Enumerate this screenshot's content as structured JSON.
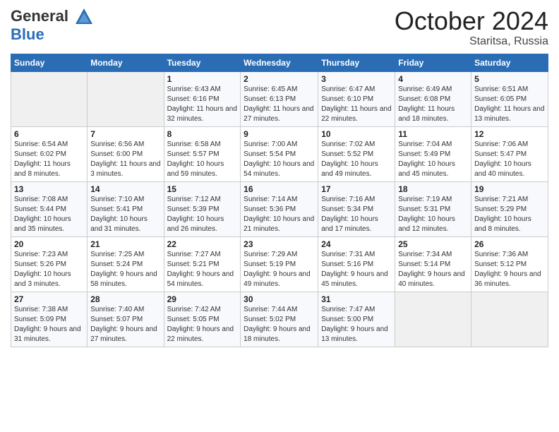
{
  "header": {
    "logo_line1": "General",
    "logo_line2": "Blue",
    "month": "October 2024",
    "location": "Staritsa, Russia"
  },
  "days_of_week": [
    "Sunday",
    "Monday",
    "Tuesday",
    "Wednesday",
    "Thursday",
    "Friday",
    "Saturday"
  ],
  "weeks": [
    [
      {
        "day": "",
        "sunrise": "",
        "sunset": "",
        "daylight": ""
      },
      {
        "day": "",
        "sunrise": "",
        "sunset": "",
        "daylight": ""
      },
      {
        "day": "1",
        "sunrise": "Sunrise: 6:43 AM",
        "sunset": "Sunset: 6:16 PM",
        "daylight": "Daylight: 11 hours and 32 minutes."
      },
      {
        "day": "2",
        "sunrise": "Sunrise: 6:45 AM",
        "sunset": "Sunset: 6:13 PM",
        "daylight": "Daylight: 11 hours and 27 minutes."
      },
      {
        "day": "3",
        "sunrise": "Sunrise: 6:47 AM",
        "sunset": "Sunset: 6:10 PM",
        "daylight": "Daylight: 11 hours and 22 minutes."
      },
      {
        "day": "4",
        "sunrise": "Sunrise: 6:49 AM",
        "sunset": "Sunset: 6:08 PM",
        "daylight": "Daylight: 11 hours and 18 minutes."
      },
      {
        "day": "5",
        "sunrise": "Sunrise: 6:51 AM",
        "sunset": "Sunset: 6:05 PM",
        "daylight": "Daylight: 11 hours and 13 minutes."
      }
    ],
    [
      {
        "day": "6",
        "sunrise": "Sunrise: 6:54 AM",
        "sunset": "Sunset: 6:02 PM",
        "daylight": "Daylight: 11 hours and 8 minutes."
      },
      {
        "day": "7",
        "sunrise": "Sunrise: 6:56 AM",
        "sunset": "Sunset: 6:00 PM",
        "daylight": "Daylight: 11 hours and 3 minutes."
      },
      {
        "day": "8",
        "sunrise": "Sunrise: 6:58 AM",
        "sunset": "Sunset: 5:57 PM",
        "daylight": "Daylight: 10 hours and 59 minutes."
      },
      {
        "day": "9",
        "sunrise": "Sunrise: 7:00 AM",
        "sunset": "Sunset: 5:54 PM",
        "daylight": "Daylight: 10 hours and 54 minutes."
      },
      {
        "day": "10",
        "sunrise": "Sunrise: 7:02 AM",
        "sunset": "Sunset: 5:52 PM",
        "daylight": "Daylight: 10 hours and 49 minutes."
      },
      {
        "day": "11",
        "sunrise": "Sunrise: 7:04 AM",
        "sunset": "Sunset: 5:49 PM",
        "daylight": "Daylight: 10 hours and 45 minutes."
      },
      {
        "day": "12",
        "sunrise": "Sunrise: 7:06 AM",
        "sunset": "Sunset: 5:47 PM",
        "daylight": "Daylight: 10 hours and 40 minutes."
      }
    ],
    [
      {
        "day": "13",
        "sunrise": "Sunrise: 7:08 AM",
        "sunset": "Sunset: 5:44 PM",
        "daylight": "Daylight: 10 hours and 35 minutes."
      },
      {
        "day": "14",
        "sunrise": "Sunrise: 7:10 AM",
        "sunset": "Sunset: 5:41 PM",
        "daylight": "Daylight: 10 hours and 31 minutes."
      },
      {
        "day": "15",
        "sunrise": "Sunrise: 7:12 AM",
        "sunset": "Sunset: 5:39 PM",
        "daylight": "Daylight: 10 hours and 26 minutes."
      },
      {
        "day": "16",
        "sunrise": "Sunrise: 7:14 AM",
        "sunset": "Sunset: 5:36 PM",
        "daylight": "Daylight: 10 hours and 21 minutes."
      },
      {
        "day": "17",
        "sunrise": "Sunrise: 7:16 AM",
        "sunset": "Sunset: 5:34 PM",
        "daylight": "Daylight: 10 hours and 17 minutes."
      },
      {
        "day": "18",
        "sunrise": "Sunrise: 7:19 AM",
        "sunset": "Sunset: 5:31 PM",
        "daylight": "Daylight: 10 hours and 12 minutes."
      },
      {
        "day": "19",
        "sunrise": "Sunrise: 7:21 AM",
        "sunset": "Sunset: 5:29 PM",
        "daylight": "Daylight: 10 hours and 8 minutes."
      }
    ],
    [
      {
        "day": "20",
        "sunrise": "Sunrise: 7:23 AM",
        "sunset": "Sunset: 5:26 PM",
        "daylight": "Daylight: 10 hours and 3 minutes."
      },
      {
        "day": "21",
        "sunrise": "Sunrise: 7:25 AM",
        "sunset": "Sunset: 5:24 PM",
        "daylight": "Daylight: 9 hours and 58 minutes."
      },
      {
        "day": "22",
        "sunrise": "Sunrise: 7:27 AM",
        "sunset": "Sunset: 5:21 PM",
        "daylight": "Daylight: 9 hours and 54 minutes."
      },
      {
        "day": "23",
        "sunrise": "Sunrise: 7:29 AM",
        "sunset": "Sunset: 5:19 PM",
        "daylight": "Daylight: 9 hours and 49 minutes."
      },
      {
        "day": "24",
        "sunrise": "Sunrise: 7:31 AM",
        "sunset": "Sunset: 5:16 PM",
        "daylight": "Daylight: 9 hours and 45 minutes."
      },
      {
        "day": "25",
        "sunrise": "Sunrise: 7:34 AM",
        "sunset": "Sunset: 5:14 PM",
        "daylight": "Daylight: 9 hours and 40 minutes."
      },
      {
        "day": "26",
        "sunrise": "Sunrise: 7:36 AM",
        "sunset": "Sunset: 5:12 PM",
        "daylight": "Daylight: 9 hours and 36 minutes."
      }
    ],
    [
      {
        "day": "27",
        "sunrise": "Sunrise: 7:38 AM",
        "sunset": "Sunset: 5:09 PM",
        "daylight": "Daylight: 9 hours and 31 minutes."
      },
      {
        "day": "28",
        "sunrise": "Sunrise: 7:40 AM",
        "sunset": "Sunset: 5:07 PM",
        "daylight": "Daylight: 9 hours and 27 minutes."
      },
      {
        "day": "29",
        "sunrise": "Sunrise: 7:42 AM",
        "sunset": "Sunset: 5:05 PM",
        "daylight": "Daylight: 9 hours and 22 minutes."
      },
      {
        "day": "30",
        "sunrise": "Sunrise: 7:44 AM",
        "sunset": "Sunset: 5:02 PM",
        "daylight": "Daylight: 9 hours and 18 minutes."
      },
      {
        "day": "31",
        "sunrise": "Sunrise: 7:47 AM",
        "sunset": "Sunset: 5:00 PM",
        "daylight": "Daylight: 9 hours and 13 minutes."
      },
      {
        "day": "",
        "sunrise": "",
        "sunset": "",
        "daylight": ""
      },
      {
        "day": "",
        "sunrise": "",
        "sunset": "",
        "daylight": ""
      }
    ]
  ]
}
